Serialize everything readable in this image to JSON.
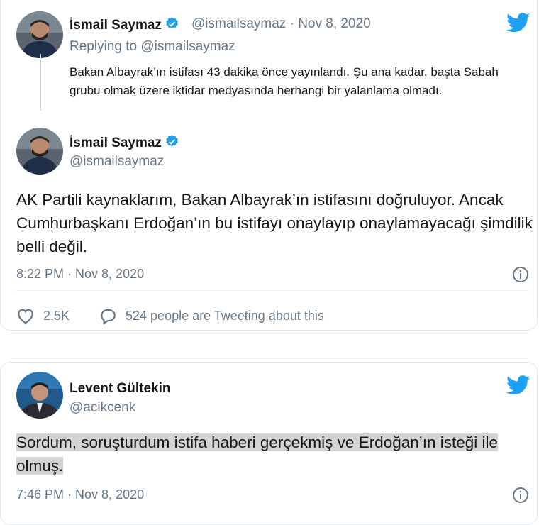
{
  "tweets": {
    "reply_context": {
      "author_name": "İsmail Saymaz",
      "handle": "@ismailsaymaz",
      "separator": "·",
      "date": "Nov 8, 2020",
      "replying_prefix": "Replying to",
      "replying_handle": "@ismailsaymaz",
      "text": "Bakan Albayrak’ın istifası 43 dakika önce yayınlandı. Şu ana kadar, başta Sabah grubu olmak üzere iktidar medyasında herhangi bir yalanlama olmadı."
    },
    "main": {
      "author_name": "İsmail Saymaz",
      "handle": "@ismailsaymaz",
      "text": "AK Partili kaynaklarım, Bakan Albayrak’ın istifasını doğruluyor. Ancak Cumhurbaşkanı Erdoğan’ın bu istifayı onaylayıp onaylamayacağı şimdilik belli değil.",
      "timestamp": "8:22 PM · Nov 8, 2020",
      "likes": "2.5K",
      "tweeting_about": "524 people are Tweeting about this"
    },
    "second": {
      "author_name": "Levent Gültekin",
      "handle": "@acikcenk",
      "text": "Sordum, soruşturdum istifa haberi gerçekmiş ve Erdoğan’ın isteği ile olmuş.",
      "timestamp": "7:46 PM · Nov 8, 2020"
    }
  },
  "colors": {
    "twitter_blue": "#1da1f2",
    "muted": "#657786",
    "highlight": "#d4d4d4"
  },
  "icons": [
    "twitter-bird-icon",
    "verified-badge-icon",
    "info-icon",
    "heart-icon",
    "reply-bubble-icon"
  ]
}
